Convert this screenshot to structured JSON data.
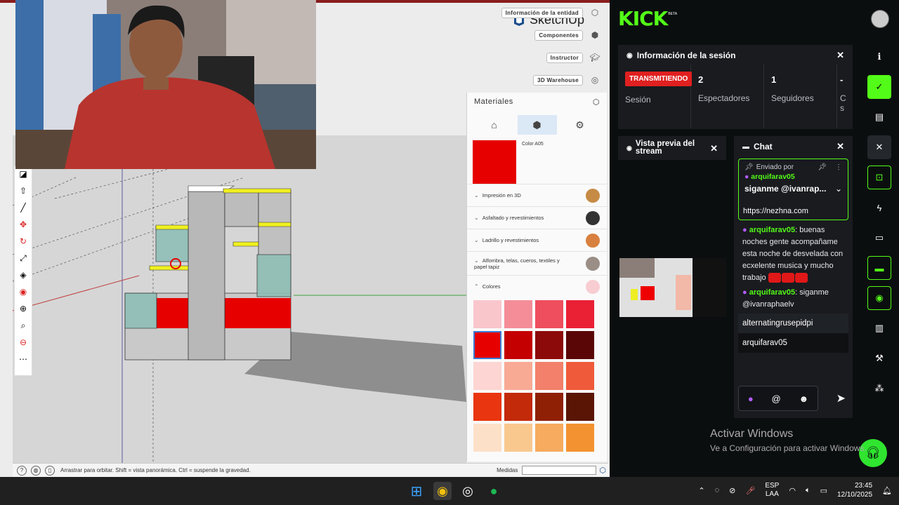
{
  "sketchup": {
    "brand": "SketchUp",
    "tabs": [
      {
        "label": "Información de la entidad"
      },
      {
        "label": "Componentes"
      },
      {
        "label": "Instructor"
      },
      {
        "label": "3D Warehouse"
      }
    ],
    "materials": {
      "title": "Materiales",
      "selected_color_name": "Color A05",
      "categories": [
        {
          "label": "Impresión en 3D",
          "color": "#c68b45"
        },
        {
          "label": "Asfaltado y revestimientos",
          "color": "#333333"
        },
        {
          "label": "Ladrillo y revestimientos",
          "color": "#d8803f"
        },
        {
          "label": "Alfombra, telas, cueros, textiles y papel tapiz",
          "color": "#9a8e86"
        },
        {
          "label": "Colores",
          "color": "#f7cdd2"
        }
      ],
      "palette": [
        "#f9c6cc",
        "#f48d98",
        "#ee4e5d",
        "#ea2035",
        "#e60000",
        "#c40000",
        "#8d0a0a",
        "#5a0606",
        "#fdd5d2",
        "#f8aa95",
        "#f3806a",
        "#ef5b3a",
        "#e93510",
        "#c22a0a",
        "#8f2006",
        "#5a1505",
        "#fde0c8",
        "#f9c88f",
        "#f6ab5e",
        "#f39231"
      ]
    },
    "status": {
      "hint": "Arrastrar para orbitar. Shift = vista panorámica. Ctrl = suspende la gravedad.",
      "measures_label": "Medidas"
    }
  },
  "kick": {
    "logo": "KICK",
    "beta": "BETA",
    "session": {
      "title": "Información de la sesión",
      "status_badge": "TRANSMITIENDO",
      "status_label": "Sesión",
      "viewers": "2",
      "viewers_label": "Espectadores",
      "followers": "1",
      "followers_label": "Seguidores",
      "extra_num": "-",
      "extra_label": "C s"
    },
    "preview": {
      "title": "Vista previa del stream"
    },
    "chat": {
      "title": "Chat",
      "pinned_by": "Enviado por",
      "pinned_user": "arquifarav05",
      "pinned_msg": "siganme @ivanrap...",
      "pinned_url": "https://nezhna.com",
      "messages": [
        {
          "user": "arquifarav05",
          "text": "buenas noches gente acompañame esta noche de desvelada con ecxelente musica y mucho trabajo"
        },
        {
          "user": "arquifarav05",
          "text": "siganme @ivanraphaelv"
        }
      ],
      "suggestions": [
        "alternatingrusepidpi",
        "arquifarav05"
      ],
      "input_at": "@"
    }
  },
  "windows": {
    "activate_title": "Activar Windows",
    "activate_sub": "Ve a Configuración para activar Windows.",
    "lang_top": "ESP",
    "lang_bottom": "LAA",
    "time": "23:45",
    "date": "12/10/2025"
  }
}
